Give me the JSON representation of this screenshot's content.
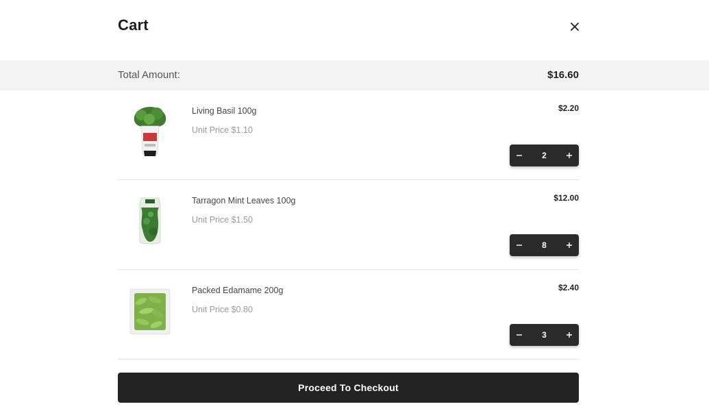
{
  "header": {
    "title": "Cart",
    "close_icon": "close-icon"
  },
  "total": {
    "label": "Total Amount:",
    "value": "$16.60"
  },
  "items": [
    {
      "name": "Living Basil 100g",
      "unit_price": "Unit Price $1.10",
      "line_total": "$2.20",
      "quantity": "2",
      "image": "basil-pot-image"
    },
    {
      "name": "Tarragon Mint Leaves 100g",
      "unit_price": "Unit Price $1.50",
      "line_total": "$12.00",
      "quantity": "8",
      "image": "herb-bag-image"
    },
    {
      "name": "Packed Edamame 200g",
      "unit_price": "Unit Price $0.80",
      "line_total": "$2.40",
      "quantity": "3",
      "image": "edamame-pack-image"
    }
  ],
  "stepper": {
    "minus_icon": "minus-icon",
    "plus_icon": "plus-icon"
  },
  "checkout": {
    "label": "Proceed To Checkout"
  },
  "colors": {
    "accent_dark": "#232323",
    "total_bar_bg": "#f3f3f3",
    "divider": "#e2e2e2"
  }
}
